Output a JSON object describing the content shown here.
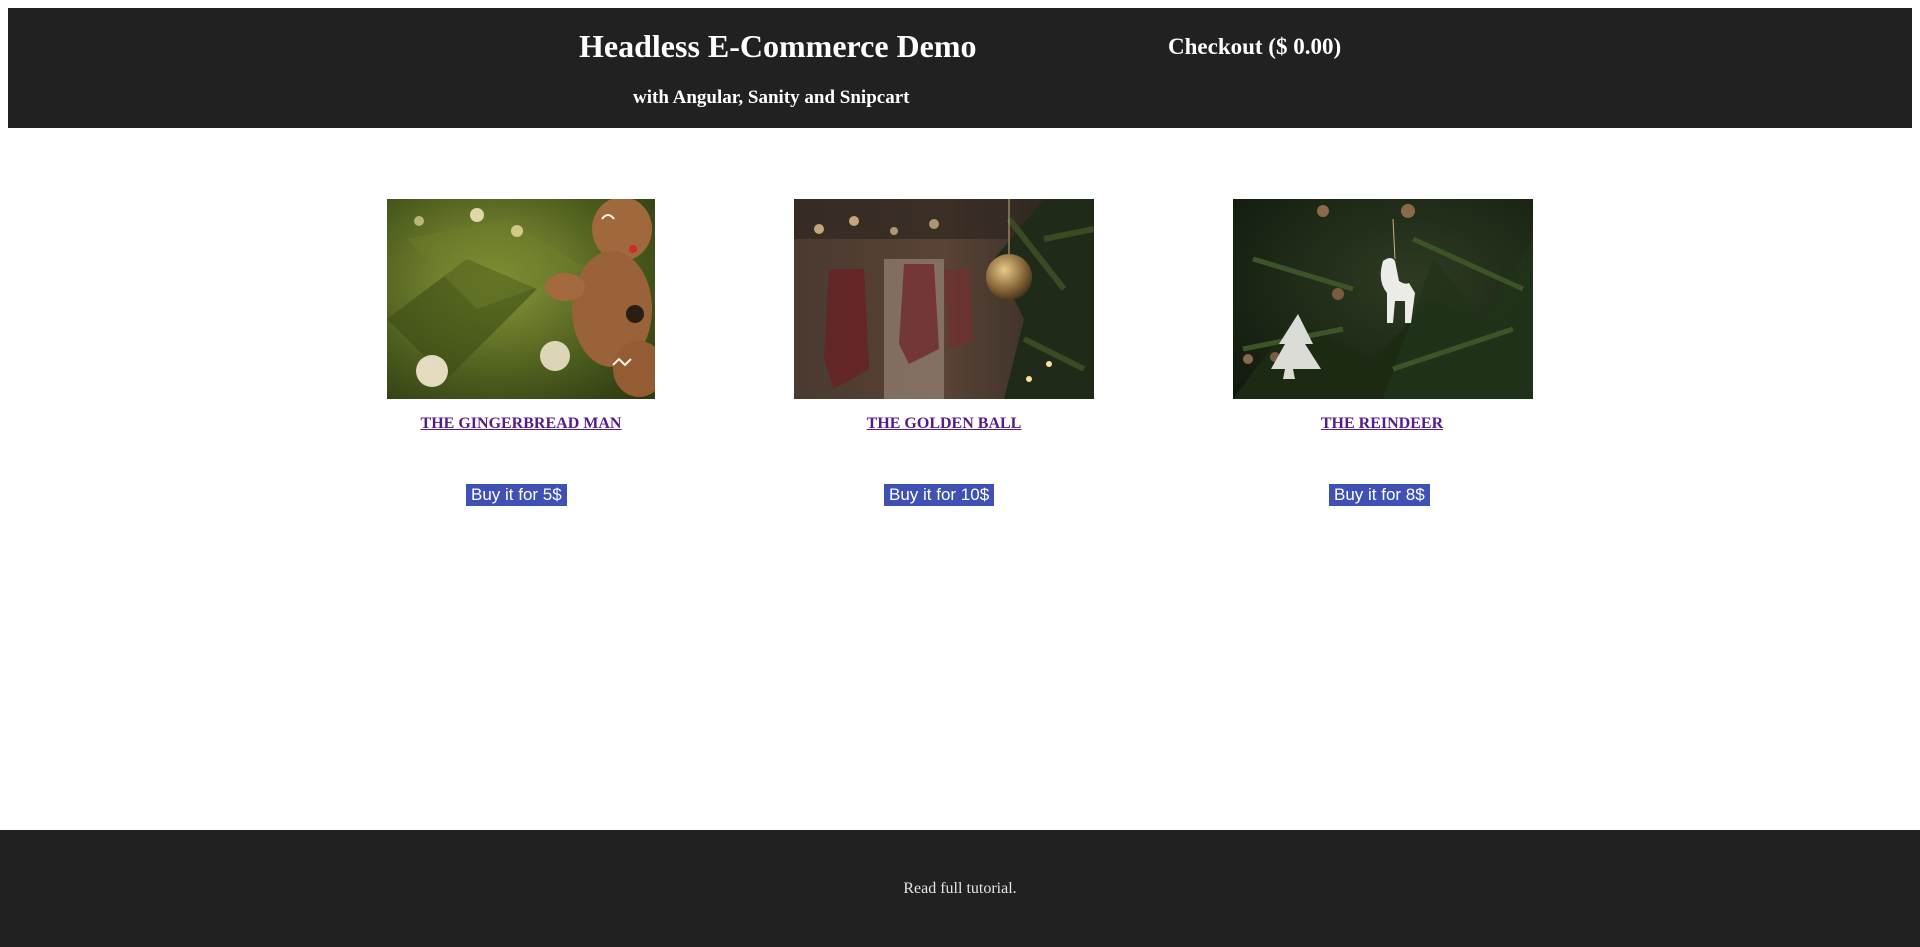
{
  "header": {
    "title": "Headless E-Commerce Demo",
    "subtitle": "with Angular, Sanity and Snipcart",
    "checkout_label": "Checkout ($ 0.00)"
  },
  "products": [
    {
      "name": "THE GINGERBREAD MAN",
      "buy_label": "Buy it for 5$",
      "image": "gingerbread-ornament-photo"
    },
    {
      "name": "THE GOLDEN BALL",
      "buy_label": "Buy it for 10$",
      "image": "golden-ball-ornament-photo"
    },
    {
      "name": "THE REINDEER",
      "buy_label": "Buy it for 8$",
      "image": "reindeer-ornament-photo"
    }
  ],
  "footer": {
    "link_label": "Read full tutorial."
  },
  "colors": {
    "header_bg": "#212121",
    "button_bg": "#3f51b5",
    "link_visited": "#551a8b"
  }
}
